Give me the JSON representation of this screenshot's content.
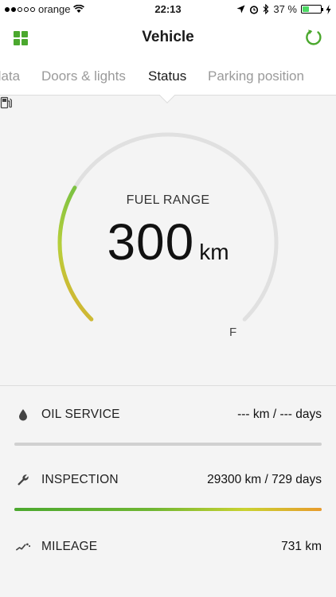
{
  "status_bar": {
    "carrier": "orange",
    "time": "22:13",
    "battery_text": "37 %",
    "battery_level": 0.37
  },
  "header": {
    "title": "Vehicle"
  },
  "tabs": [
    {
      "label": "data",
      "active": false
    },
    {
      "label": "Doors & lights",
      "active": false
    },
    {
      "label": "Status",
      "active": true
    },
    {
      "label": "Parking position",
      "active": false
    }
  ],
  "fuel": {
    "label": "FUEL RANGE",
    "value": "300",
    "unit": "km",
    "full_label": "F",
    "level": 0.28
  },
  "services": {
    "oil": {
      "label": "OIL SERVICE",
      "value": "--- km / --- days",
      "progress": 0
    },
    "inspection": {
      "label": "INSPECTION",
      "value": "29300 km / 729 days",
      "progress": 1.0
    },
    "mileage": {
      "label": "MILEAGE",
      "value": "731 km"
    }
  },
  "colors": {
    "accent": "#4ba82e",
    "gauge_track": "#e0e0e0",
    "gauge_low": "#e8a02c",
    "gauge_high": "#7dc242"
  }
}
